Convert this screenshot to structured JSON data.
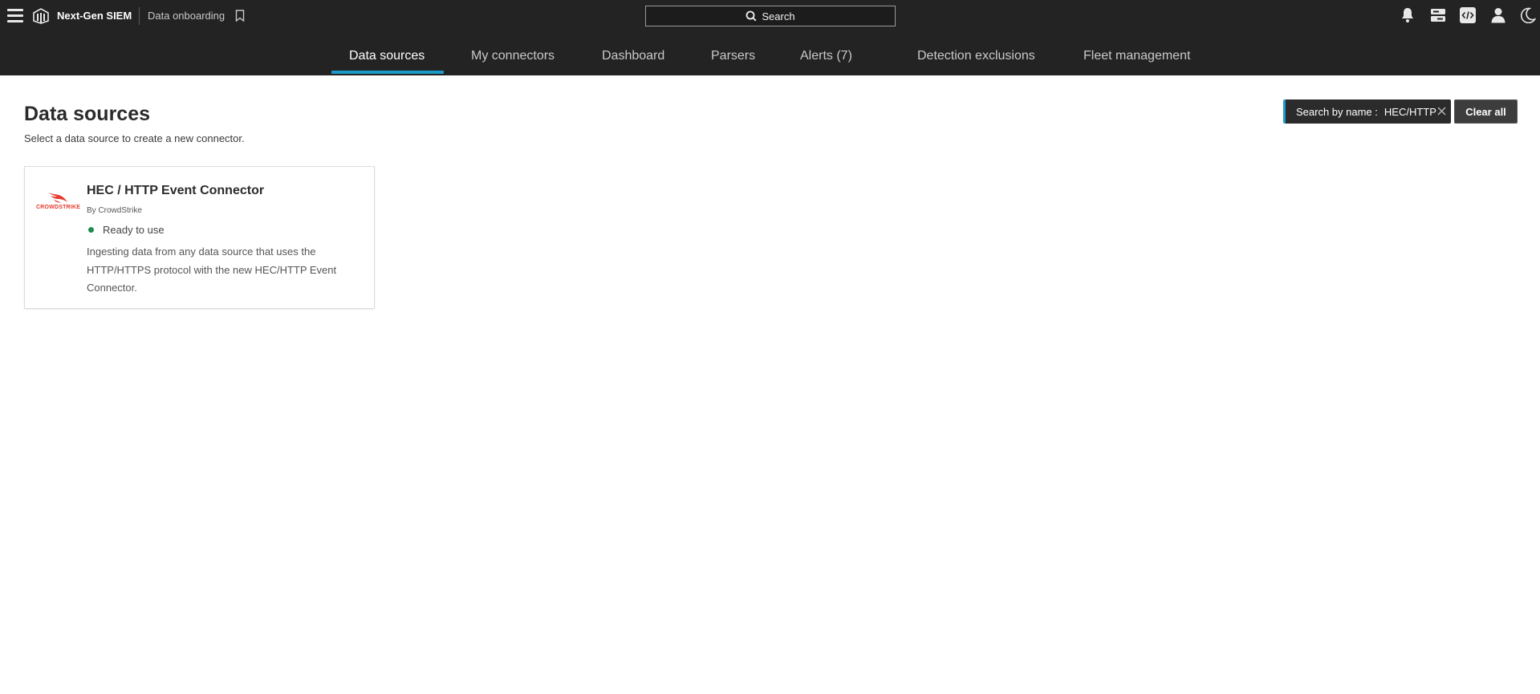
{
  "header": {
    "app_name": "Next-Gen SIEM",
    "page_crumb": "Data onboarding",
    "search_label": "Search",
    "icons": [
      "menu-icon",
      "falcon-logo-icon",
      "bookmark-icon",
      "search-icon",
      "bell-icon",
      "messages-icon",
      "code-icon",
      "user-icon",
      "moon-icon"
    ]
  },
  "tabs": [
    {
      "label": "Data sources",
      "active": true
    },
    {
      "label": "My connectors",
      "active": false
    },
    {
      "label": "Dashboard",
      "active": false
    },
    {
      "label": "Parsers",
      "active": false
    },
    {
      "label": "Alerts (7)",
      "active": false
    },
    {
      "label": "Detection exclusions",
      "active": false
    },
    {
      "label": "Fleet management",
      "active": false
    }
  ],
  "main": {
    "title": "Data sources",
    "subtitle": "Select a data source to create a new connector.",
    "filter": {
      "label": "Search by name :",
      "value": "HEC/HTTP"
    },
    "clear_all": "Clear all",
    "cards": [
      {
        "logo_text": "CROWDSTRIKE",
        "title": "HEC / HTTP Event Connector",
        "by": "By CrowdStrike",
        "status": "Ready to use",
        "description": "Ingesting data from any data source that uses the HTTP/HTTPS protocol with the new HEC/HTTP Event Connector."
      }
    ]
  },
  "colors": {
    "topbar_bg": "#232323",
    "accent": "#1a9ac9",
    "status_ready": "#1f8a4c",
    "brand_red": "#e53a2e"
  }
}
